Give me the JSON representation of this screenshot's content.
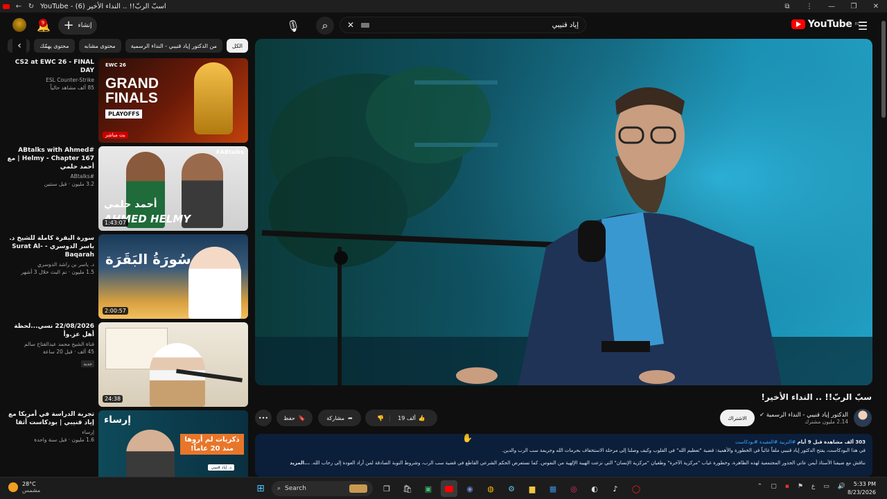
{
  "window": {
    "tab_title": "YouTube - اسبّ الربّ!! .. النداء الأخير (6)"
  },
  "header": {
    "logo_text": "YouTube",
    "logo_sup": "EG",
    "search_query": "إياد قنيبي",
    "create_label": "إنشاء",
    "notifications_count": "9"
  },
  "chips": [
    "الكل",
    "من الدكتور إياد قنيبي - النداء الرسمية",
    "محتوى مشابه",
    "محتوى يهمّك",
    "فيديو"
  ],
  "recommendations": [
    {
      "title": "CS2 at EWC 26 - FINAL DAY",
      "channel": "ESL Counter-Strike",
      "stats": "85 ألف مشاهد حالياً",
      "badge": "بث مباشر",
      "thumb_text1": "GRAND",
      "thumb_text2": "FINALS",
      "thumb_text3": "PLAYOFFS",
      "thumb_brand": "EWC 26"
    },
    {
      "title": "#ABtalks with Ahmed Helmy - Chapter 167 | مع أحمد حلمي",
      "channel": "#ABtalks",
      "stats": "3.2 مليون · قبل سنتين",
      "duration": "1:43:07",
      "thumb_text1": "أحمد حلمي",
      "thumb_text2": "AHMED HELMY",
      "thumb_tag": "#ABtalks"
    },
    {
      "title": "سورة البقرة كاملة للشيخ د. ياسر الدوسري - Surat Al-Baqarah",
      "channel": "د. ياسر بن راشد الدوسري",
      "stats": "1.5 مليون · تم البث خلال 3 أشهر",
      "duration": "2:00:57",
      "thumb_text1": "سُورَةُ البَقَرَة"
    },
    {
      "title": "22/08/2026 نسي...لحظة أهل عز.وأ",
      "channel": "قناة الشيخ محمد عبدالفتاح سالم",
      "stats": "45 ألف · قبل 20 ساعة",
      "badge": "جديد",
      "duration": "24:38"
    },
    {
      "title": "تجربة الدراسة في أمريكا مع إياد قنيبي | بودكاست أثقا",
      "channel": "إرساء",
      "stats": "1.6 مليون · قبل سنة واحدة",
      "thumb_text1": "إرساء",
      "thumb_text2": "ذكريات لم أروها منذ 20 عاماً!",
      "thumb_text3": "د. إياد قنيبي"
    }
  ],
  "video": {
    "title": "سبّ الربّ!! .. النداء الأخير!",
    "channel": "الدكتور إياد قنيبي - النداء الرسمية",
    "subscribers": "2.14 مليون مشترك",
    "subscribe_label": "الاشتراك",
    "likes": "19 ألف",
    "share_label": "مشاركة",
    "save_label": "حفظ"
  },
  "description": {
    "views": "303 ألف مشاهدة",
    "date": "قبل 9 أيام",
    "tags": "#التربية #العقيدة #بودكاست",
    "line1": "في هذا البودكاست، يفتح الدكتور إياد قنيبي ملفاً غائباً في الخطورة والأهمية: قضية \"تعظيم الله\" في القلوب وكيف وصلنا إلى مرحلة الاستخفاف بحرمات الله وجريمة سب الرب والدين.",
    "line2": "نناقش مع ضيفنا الأستاذ أيمن عاتي الجذور المجتمعية لهذه الظاهرة، وخطورة غياب \"مركزية الآخرة\" وطغيان \"مركزية الإنسان\" التي نزعت الهيبة الإلهية من النفوس. كما نستعرض الحكم الشرعي القاطع في قضية سب الرب، وشروط التوبة الصادقة لمن أراد العودة إلى رحاب الله.",
    "more": "...المزيد"
  },
  "taskbar": {
    "temp": "28°C",
    "weather": "مشمس",
    "search_label": "Search",
    "time": "5:33 PM",
    "date": "8/23/2026",
    "lang": "ع"
  }
}
